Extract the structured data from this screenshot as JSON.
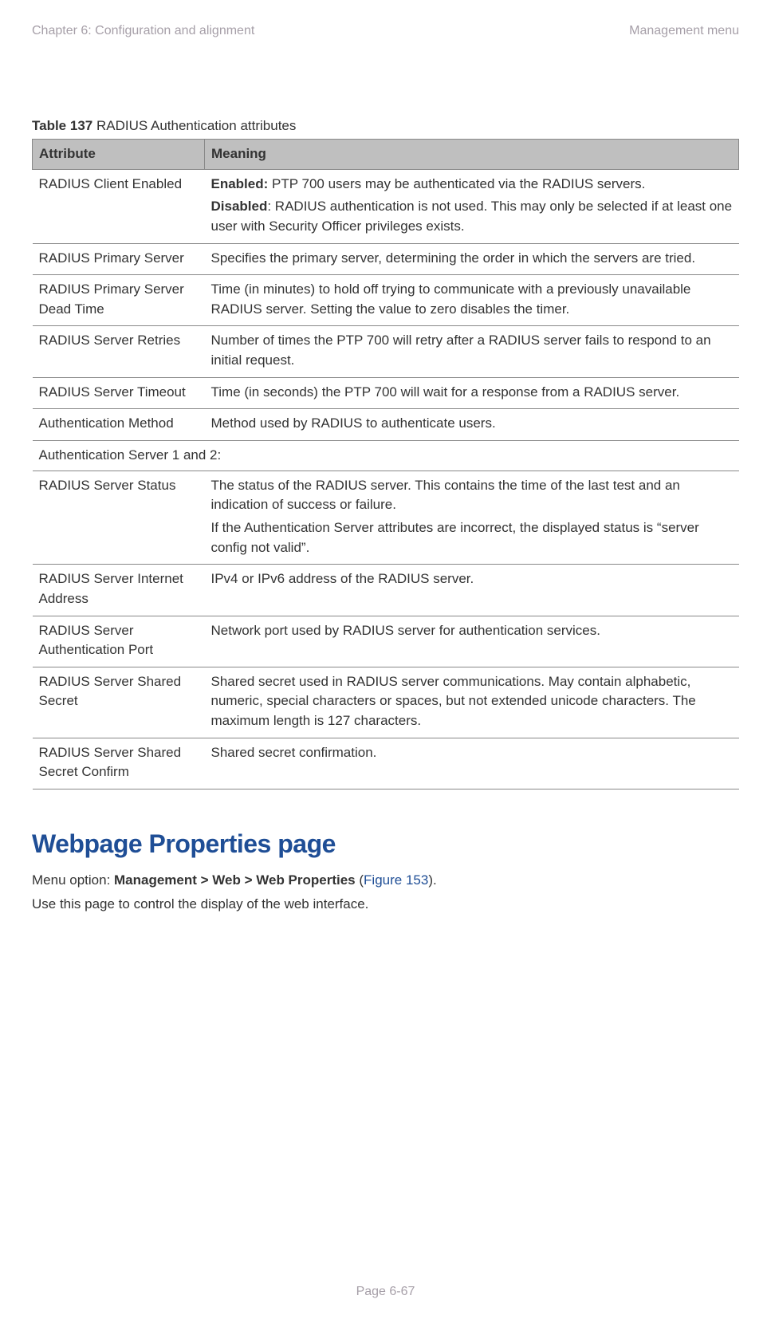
{
  "header": {
    "left": "Chapter 6:  Configuration and alignment",
    "right": "Management menu"
  },
  "table": {
    "caption_label": "Table 137",
    "caption_text": "  RADIUS Authentication attributes",
    "head_attr": "Attribute",
    "head_mean": "Meaning",
    "rows": [
      {
        "attr": "RADIUS Client Enabled",
        "mean_parts": [
          {
            "bold": "Enabled:",
            "rest": " PTP 700 users may be authenticated via the RADIUS servers."
          },
          {
            "bold": "Disabled",
            "rest": ": RADIUS authentication is not used. This may only be selected if at least one user with Security Officer privileges exists."
          }
        ]
      },
      {
        "attr": "RADIUS Primary Server",
        "mean": "Specifies the primary server, determining the order in which the servers are tried."
      },
      {
        "attr": "RADIUS Primary Server Dead Time",
        "mean": "Time (in minutes) to hold off trying to communicate with a previously unavailable RADIUS server. Setting the value to zero disables the timer."
      },
      {
        "attr": "RADIUS Server Retries",
        "mean": "Number of times the PTP 700 will retry after a RADIUS server fails to respond to an initial request."
      },
      {
        "attr": "RADIUS Server Timeout",
        "mean": "Time (in seconds) the PTP 700 will wait for a response from a RADIUS server."
      },
      {
        "attr": "Authentication Method",
        "mean": "Method used by RADIUS to authenticate users."
      },
      {
        "span": "Authentication Server 1 and 2:"
      },
      {
        "attr": "RADIUS Server Status",
        "mean_multi": [
          "The status of the RADIUS server. This contains the time of the last test and an indication of success or failure.",
          "If the Authentication Server attributes are incorrect, the displayed status is “server config not valid”."
        ]
      },
      {
        "attr": "RADIUS Server Internet Address",
        "mean": "IPv4 or IPv6 address of the RADIUS server."
      },
      {
        "attr": "RADIUS Server Authentication Port",
        "mean": "Network port used by RADIUS server for authentication services."
      },
      {
        "attr": "RADIUS Server Shared Secret",
        "mean": "Shared secret used in RADIUS server communications. May contain alphabetic, numeric, special characters or spaces, but not extended unicode characters. The maximum length is 127 characters."
      },
      {
        "attr": "RADIUS Server Shared Secret Confirm",
        "mean": "Shared secret confirmation."
      }
    ]
  },
  "section": {
    "title": "Webpage Properties page",
    "line1_pre": "Menu option: ",
    "line1_bold": "Management > Web > Web Properties",
    "line1_open": " (",
    "line1_link": "Figure 153",
    "line1_close": ").",
    "line2": "Use this page to control the display of the web interface."
  },
  "footer": "Page 6-67"
}
